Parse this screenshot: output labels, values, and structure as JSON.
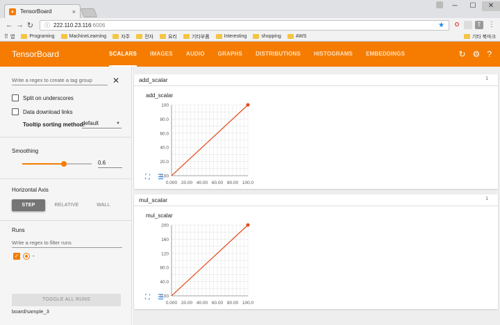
{
  "browser": {
    "tab_title": "TensorBoard",
    "tab_close": "×",
    "url_host": "222.110.23.116",
    "url_port": ":6006",
    "controls": {
      "minimize": "─",
      "maximize": "☐",
      "close": "✕"
    },
    "bookmarks": [
      {
        "label": "앱",
        "icon": "apps-icon"
      },
      {
        "label": "Programing",
        "icon": "folder-icon"
      },
      {
        "label": "MachineLearning",
        "icon": "folder-icon"
      },
      {
        "label": "자주",
        "icon": "folder-icon"
      },
      {
        "label": "전자",
        "icon": "folder-icon"
      },
      {
        "label": "요리",
        "icon": "folder-icon"
      },
      {
        "label": "기타부품",
        "icon": "folder-icon"
      },
      {
        "label": "Interesting",
        "icon": "folder-icon"
      },
      {
        "label": "shopping",
        "icon": "folder-icon"
      },
      {
        "label": "AWS",
        "icon": "folder-icon"
      }
    ],
    "other_bookmarks": "기타 북마크"
  },
  "header": {
    "brand": "TensorBoard",
    "tabs": [
      "SCALARS",
      "IMAGES",
      "AUDIO",
      "GRAPHS",
      "DISTRIBUTIONS",
      "HISTOGRAMS",
      "EMBEDDINGS"
    ],
    "active_tab": "SCALARS",
    "color": "#f57c00"
  },
  "sidebar": {
    "tag_regex_placeholder": "Write a regex to create a tag group",
    "split_underscores": "Split on underscores",
    "data_download": "Data download links",
    "tooltip_label": "Tooltip sorting method:",
    "tooltip_value": "default",
    "smoothing_label": "Smoothing",
    "smoothing_value": "0.6",
    "smoothing_fraction": 0.6,
    "axis_label": "Horizontal Axis",
    "axis_options": [
      "STEP",
      "RELATIVE",
      "WALL"
    ],
    "axis_selected": "STEP",
    "runs_label": "Runs",
    "runs_regex_placeholder": "Write a regex to filter runs",
    "run_name": "-",
    "toggle_all": "TOGGLE ALL RUNS",
    "logdir": "board/sample_3"
  },
  "chart_data": [
    {
      "type": "line",
      "title": "add_scalar",
      "x": [
        0,
        100
      ],
      "y": [
        0,
        100
      ],
      "xticks": [
        "0.000",
        "20.00",
        "40.00",
        "60.00",
        "80.00",
        "100.0"
      ],
      "yticks": [
        "0.00",
        "20.0",
        "40.0",
        "60.0",
        "80.0",
        "100"
      ],
      "xlim": [
        0,
        100
      ],
      "ylim": [
        0,
        100
      ],
      "color": "#e64a19",
      "grid": true
    },
    {
      "type": "line",
      "title": "mul_scalar",
      "x": [
        0,
        100
      ],
      "y": [
        0,
        200
      ],
      "xticks": [
        "0.000",
        "20.00",
        "40.00",
        "60.00",
        "80.00",
        "100.0"
      ],
      "yticks": [
        "0.00",
        "40.0",
        "80.0",
        "120",
        "160",
        "200"
      ],
      "xlim": [
        0,
        100
      ],
      "ylim": [
        0,
        200
      ],
      "color": "#e64a19",
      "grid": true
    }
  ],
  "cards": [
    {
      "name": "add_scalar",
      "count": "1"
    },
    {
      "name": "mul_scalar",
      "count": "1"
    }
  ]
}
